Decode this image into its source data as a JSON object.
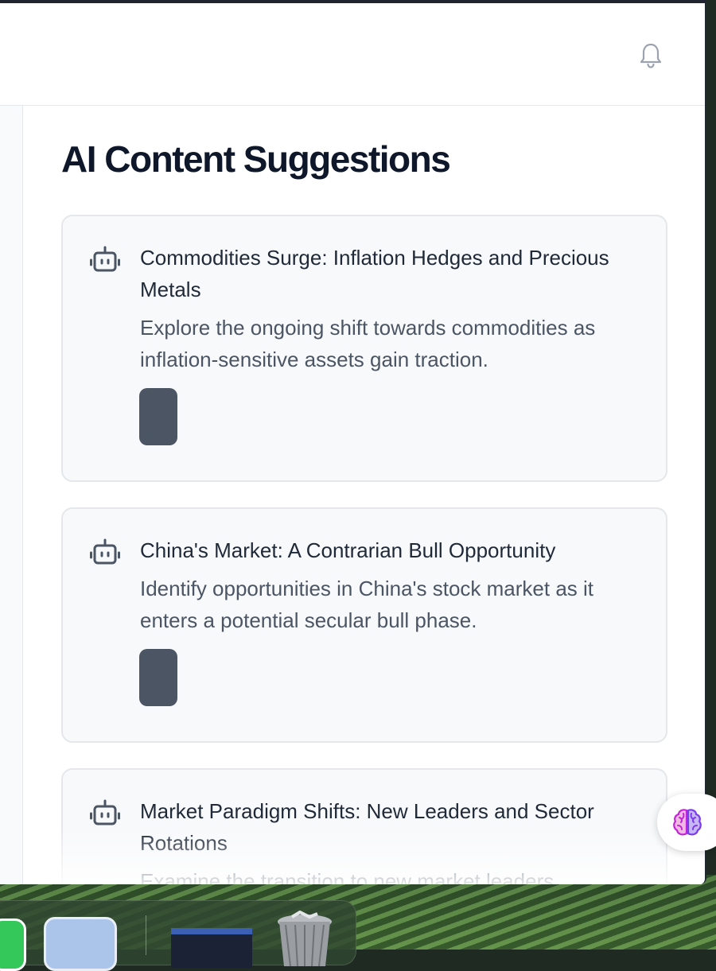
{
  "page": {
    "title": "AI Content Suggestions"
  },
  "header": {
    "notification_icon": "bell-icon"
  },
  "suggestions": [
    {
      "icon": "robot-icon",
      "title": "Commodities Surge: Inflation Hedges and Precious Metals",
      "description": "Explore the ongoing shift towards commodities as inflation-sensitive assets gain traction."
    },
    {
      "icon": "robot-icon",
      "title": "China's Market: A Contrarian Bull Opportunity",
      "description": "Identify opportunities in China's stock market as it enters a potential secular bull phase."
    },
    {
      "icon": "robot-icon",
      "title": "Market Paradigm Shifts: New Leaders and Sector Rotations",
      "description": "Examine the transition to new market leaders"
    }
  ],
  "floating_button": {
    "icon": "brain-icon"
  },
  "colors": {
    "title_text": "#0f172a",
    "card_background": "#f8f9fb",
    "card_border": "#e5e7eb",
    "action_button": "#4b5563",
    "icon_gray": "#4b5563"
  }
}
